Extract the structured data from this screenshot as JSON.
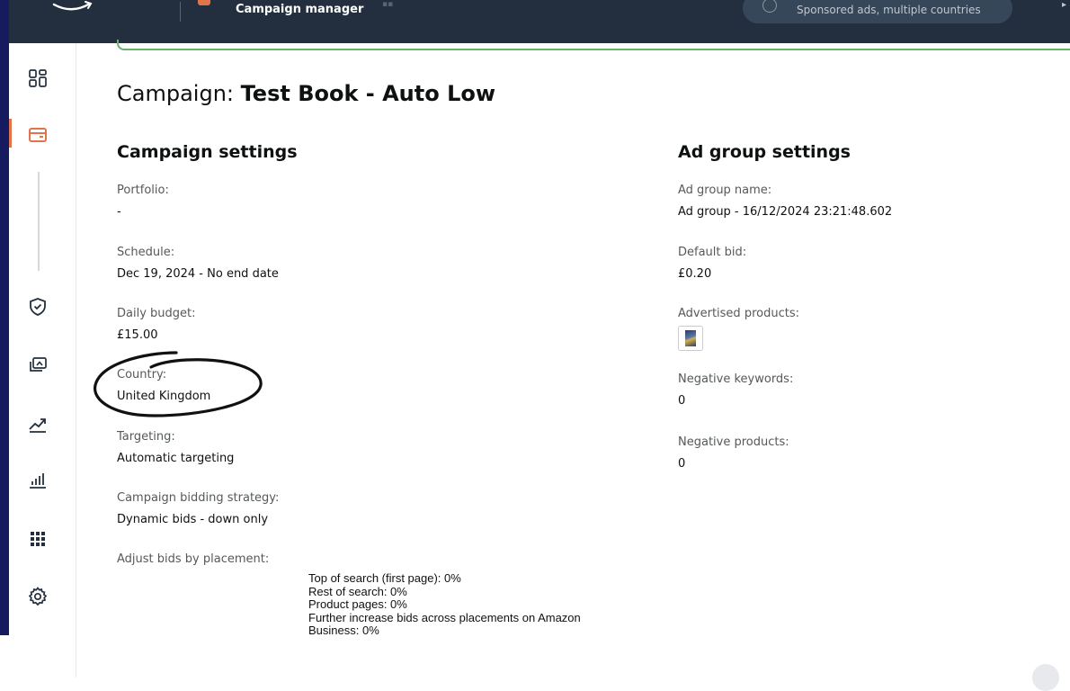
{
  "topbar": {
    "app_title": "Campaign manager",
    "account_selector": "Sponsored ads, multiple countries"
  },
  "sidebar": {
    "items": [
      {
        "name": "overview",
        "icon": "dashboard-icon"
      },
      {
        "name": "campaigns",
        "icon": "wallet-icon",
        "active": true
      },
      {
        "name": "brand-protection",
        "icon": "shield-icon"
      },
      {
        "name": "media",
        "icon": "media-icon"
      },
      {
        "name": "trends",
        "icon": "trend-up-icon"
      },
      {
        "name": "reports",
        "icon": "bar-chart-icon"
      },
      {
        "name": "apps",
        "icon": "apps-grid-icon"
      },
      {
        "name": "settings",
        "icon": "gear-icon"
      }
    ]
  },
  "page": {
    "title_prefix": "Campaign: ",
    "title_name": "Test Book - Auto Low"
  },
  "campaign_settings": {
    "heading": "Campaign settings",
    "portfolio_label": "Portfolio:",
    "portfolio_value": "-",
    "schedule_label": "Schedule:",
    "schedule_value": "Dec 19, 2024 - No end date",
    "daily_budget_label": "Daily budget:",
    "daily_budget_value": "£15.00",
    "country_label": "Country:",
    "country_value": "United Kingdom",
    "targeting_label": "Targeting:",
    "targeting_value": "Automatic targeting",
    "bidding_strategy_label": "Campaign bidding strategy:",
    "bidding_strategy_value": "Dynamic bids - down only",
    "placement_label": "Adjust bids by placement:",
    "placements": [
      "Top of search (first page): 0%",
      "Rest of search: 0%",
      "Product pages: 0%",
      "Further increase bids across placements on Amazon",
      "Business: 0%"
    ]
  },
  "ad_group_settings": {
    "heading": "Ad group settings",
    "name_label": "Ad group name:",
    "name_value": "Ad group - 16/12/2024 23:21:48.602",
    "default_bid_label": "Default bid:",
    "default_bid_value": "£0.20",
    "advertised_products_label": "Advertised products:",
    "negative_keywords_label": "Negative keywords:",
    "negative_keywords_value": "0",
    "negative_products_label": "Negative products:",
    "negative_products_value": "0"
  },
  "colors": {
    "topbar": "#232f3e",
    "accent_orange": "#e3734a",
    "accent_green": "#67b36b",
    "annotation": "#111111"
  }
}
